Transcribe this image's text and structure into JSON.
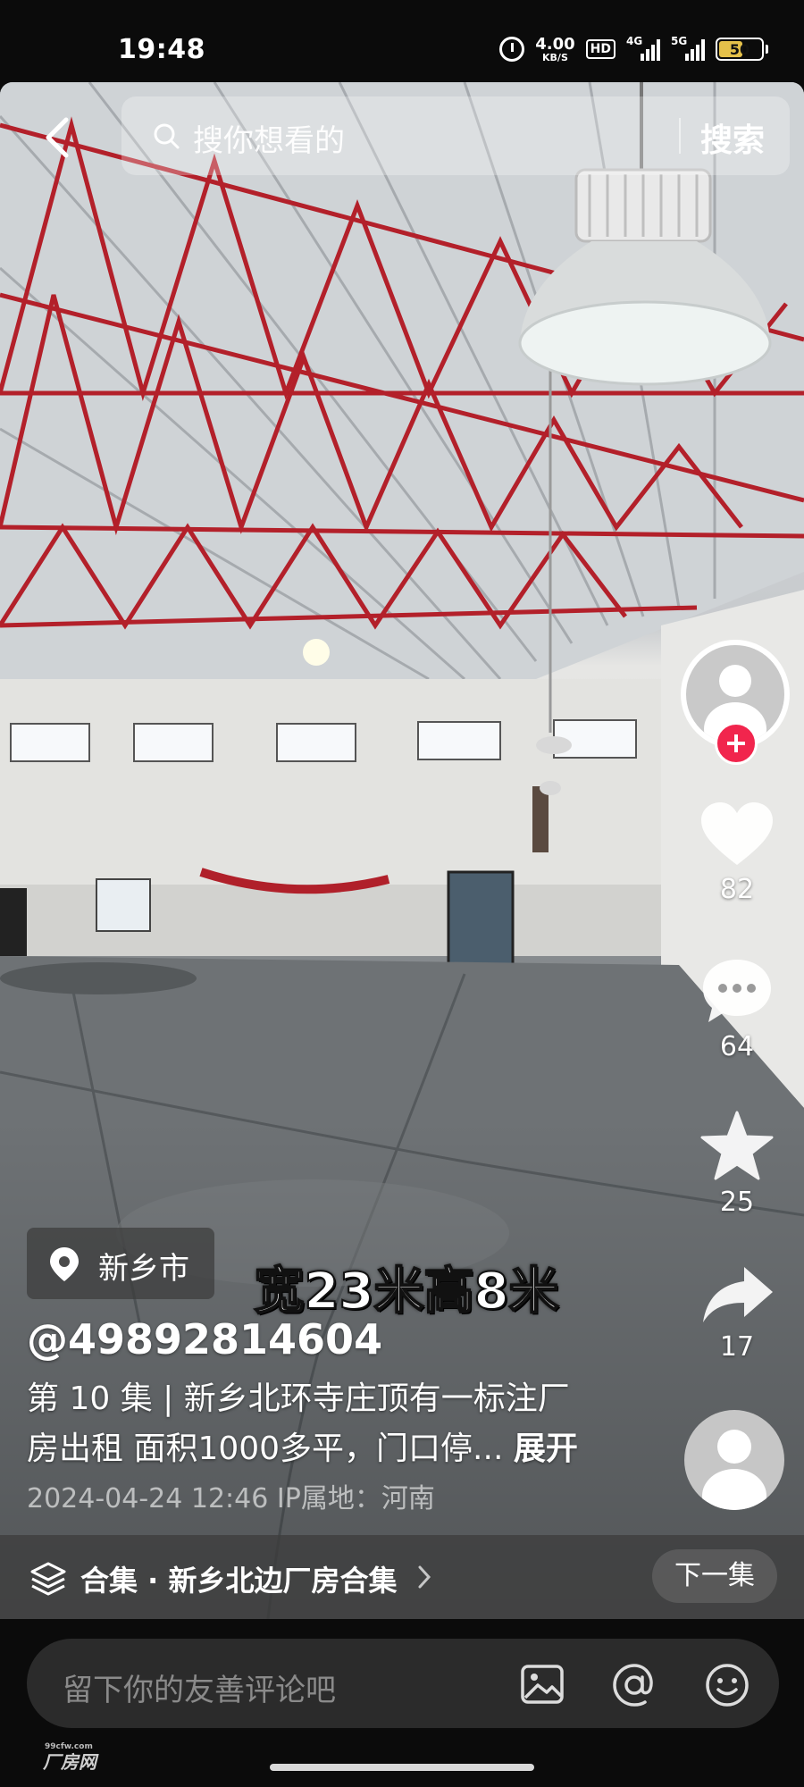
{
  "status_bar": {
    "time": "19:48",
    "speed_value": "4.00",
    "speed_unit": "KB/S",
    "hd_label": "HD",
    "net1_label": "4G",
    "net2_label": "5G",
    "battery": "50",
    "icons": [
      "alarm-icon",
      "hd-icon",
      "signal-icon",
      "battery-icon"
    ]
  },
  "search": {
    "placeholder": "搜你想看的",
    "button_label": "搜索"
  },
  "video": {
    "caption_overlay": "宽23米高8米",
    "location": "新乡市",
    "author": "@49892814604",
    "description": "第 10 集 | 新乡北环寺庄顶有一标注厂房出租 面积1000多平，门口停...",
    "expand_label": "展开",
    "date": "2024-04-24 12:46",
    "ip_location": "IP属地：河南"
  },
  "actions": {
    "likes": "82",
    "comments": "64",
    "favorites": "25",
    "shares": "17"
  },
  "collection": {
    "label": "合集 · 新乡北边厂房合集",
    "next_label": "下一集"
  },
  "comment_input": {
    "placeholder": "留下你的友善评论吧"
  },
  "watermark": {
    "text": "厂房网",
    "sub": "99cfw.com"
  },
  "colors": {
    "follow_red": "#f1254d",
    "truss_red": "#b3202a",
    "background": "#0b0b0b"
  }
}
